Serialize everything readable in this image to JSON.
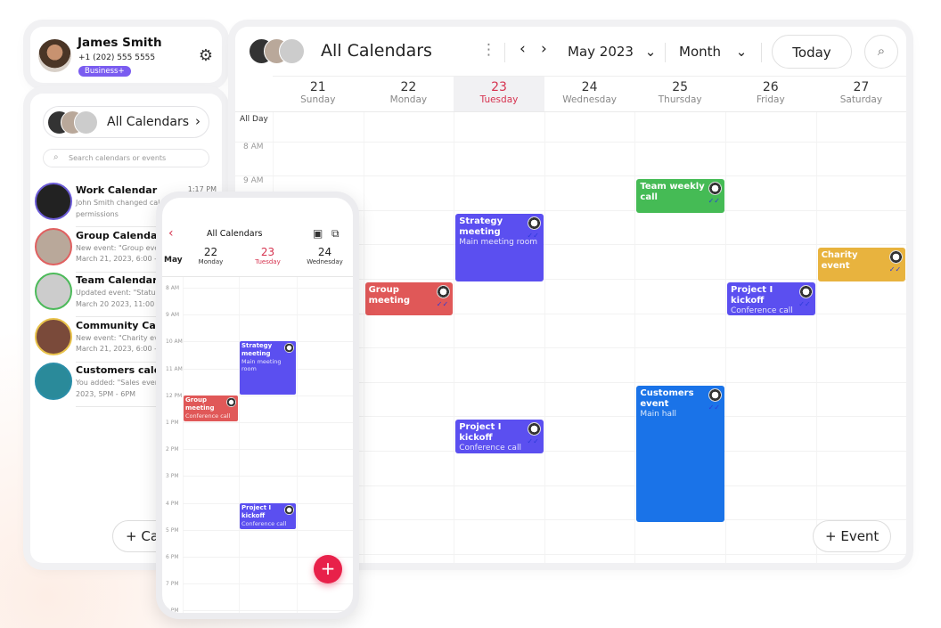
{
  "profile": {
    "name": "James Smith",
    "phone": "+1 (202) 555 5555",
    "plan": "Business+",
    "settings_icon": "gear-icon"
  },
  "sidebar": {
    "all_calendars": "All Calendars",
    "search_placeholder": "Search calendars or events",
    "add_label": "Ca",
    "items": [
      {
        "title": "Work Calendar",
        "sub": "John Smith changed calendar\npermissions",
        "time": "1:17 PM",
        "ring": "#6b5bd6",
        "bg": "#222"
      },
      {
        "title": "Group Calendar",
        "sub": "New event: \"Group event\"\nMarch 21, 2023, 6:00 - 9:00",
        "time": "",
        "ring": "#e06060",
        "bg": "#b9a89a"
      },
      {
        "title": "Team Calendar",
        "sub": "Updated event: \"Status meeting\"\nMarch 20 2023, 11:00 AM",
        "time": "",
        "ring": "#4cba5a",
        "bg": "#ccc"
      },
      {
        "title": "Community Calendar",
        "sub": "New event: \"Charity event\"\nMarch 21, 2023, 6:00 - 9:00",
        "time": "",
        "ring": "#e8c24a",
        "bg": "#7a4a3a"
      },
      {
        "title": "Customers calendar",
        "sub": "You added: \"Sales event\"\n2023, 5PM - 6PM",
        "time": "",
        "ring": "#2a8ea8",
        "bg": "#2a8a9a"
      }
    ]
  },
  "header": {
    "title": "All Calendars",
    "month": "May 2023",
    "view": "Month",
    "today": "Today",
    "search_icon": "search-icon"
  },
  "week": {
    "today_index": 2,
    "days": [
      {
        "num": "21",
        "name": "Sunday"
      },
      {
        "num": "22",
        "name": "Monday"
      },
      {
        "num": "23",
        "name": "Tuesday"
      },
      {
        "num": "24",
        "name": "Wednesday"
      },
      {
        "num": "25",
        "name": "Thursday"
      },
      {
        "num": "26",
        "name": "Friday"
      },
      {
        "num": "27",
        "name": "Saturday"
      }
    ],
    "all_day": "All Day",
    "hours": [
      "8 AM",
      "9 AM"
    ],
    "add_event": "Event",
    "events": [
      {
        "title": "Team weekly call",
        "location": "",
        "day": 4,
        "start": 9,
        "end": 10,
        "color": "#45bb55"
      },
      {
        "title": "Strategy meeting",
        "location": "Main meeting room",
        "day": 2,
        "start": 10,
        "end": 12,
        "color": "#5b4ff0"
      },
      {
        "title": "Charity event",
        "location": "",
        "day": 6,
        "start": 11,
        "end": 12,
        "color": "#e8b33e"
      },
      {
        "title": "Group meeting",
        "location": "",
        "day": 1,
        "start": 12,
        "end": 13,
        "color": "#e05858"
      },
      {
        "title": "Project I kickoff",
        "location": "Conference call",
        "day": 5,
        "start": 12,
        "end": 13,
        "color": "#5b4ff0"
      },
      {
        "title": "Customers event",
        "location": "Main hall",
        "day": 4,
        "start": 15,
        "end": 19,
        "color": "#1a73e8"
      },
      {
        "title": "Project I kickoff",
        "location": "Conference call",
        "day": 2,
        "start": 16,
        "end": 17,
        "color": "#5b4ff0"
      }
    ]
  },
  "phone": {
    "title": "All Calendars",
    "month": "May",
    "today_index": 1,
    "days": [
      {
        "num": "22",
        "name": "Monday"
      },
      {
        "num": "23",
        "name": "Tuesday"
      },
      {
        "num": "24",
        "name": "Wednesday"
      }
    ],
    "hours": [
      "8 AM",
      "9 AM",
      "10 AM",
      "11 AM",
      "12 PM",
      "1 PM",
      "2 PM",
      "3 PM",
      "4 PM",
      "5 PM",
      "6 PM",
      "7 PM",
      "8 PM"
    ],
    "events": [
      {
        "title": "Strategy meeting",
        "location": "Main meeting room",
        "day": 1,
        "start": 10,
        "end": 12,
        "color": "#5b4ff0"
      },
      {
        "title": "Group meeting",
        "location": "Conference call",
        "day": 0,
        "start": 12,
        "end": 13,
        "color": "#e05858"
      },
      {
        "title": "Project I kickoff",
        "location": "Conference call",
        "day": 1,
        "start": 16,
        "end": 17,
        "color": "#5b4ff0"
      }
    ],
    "fab_icon": "plus-icon"
  }
}
